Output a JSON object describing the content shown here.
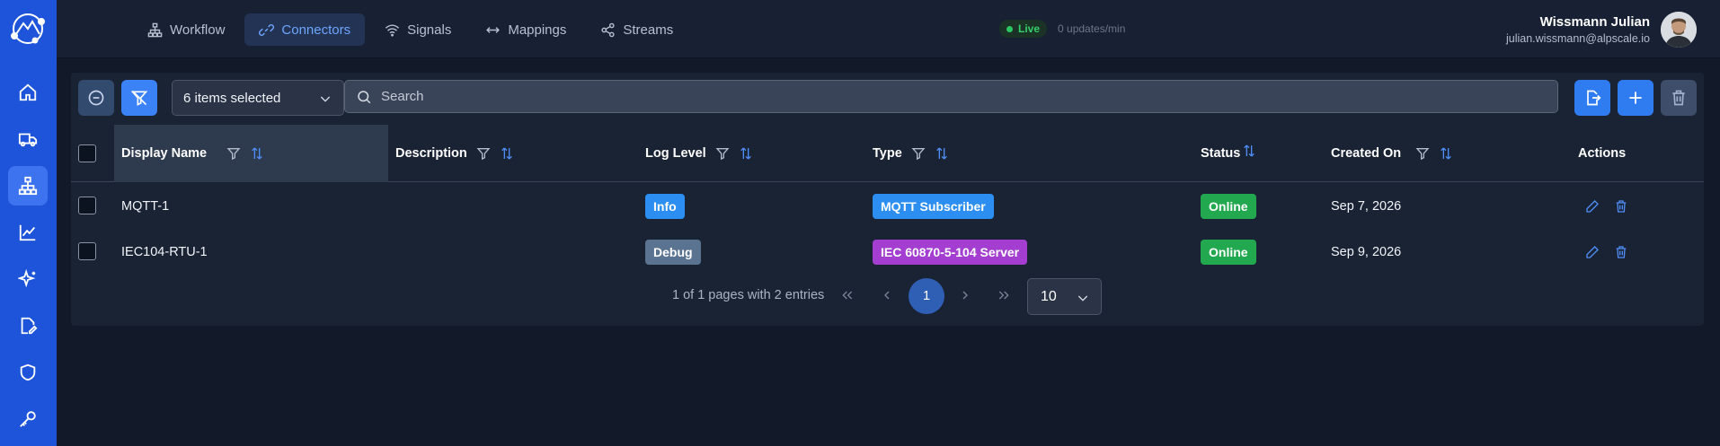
{
  "nav": {
    "tabs": [
      {
        "label": "Workflow",
        "icon": "workflow-icon"
      },
      {
        "label": "Connectors",
        "icon": "link-icon",
        "active": true
      },
      {
        "label": "Signals",
        "icon": "wifi-icon"
      },
      {
        "label": "Mappings",
        "icon": "arrows-icon"
      },
      {
        "label": "Streams",
        "icon": "share-icon"
      }
    ]
  },
  "status": {
    "live_label": "Live",
    "rate": "0 updates/min"
  },
  "user": {
    "name": "Wissmann Julian",
    "email": "julian.wissmann@alpscale.io"
  },
  "toolbar": {
    "selection_label": "6 items selected",
    "search_placeholder": "Search"
  },
  "table": {
    "headers": {
      "display_name": "Display Name",
      "description": "Description",
      "log_level": "Log Level",
      "type": "Type",
      "status": "Status",
      "created_on": "Created On",
      "actions": "Actions"
    },
    "rows": [
      {
        "display_name": "MQTT-1",
        "description": "",
        "log_level": "Info",
        "type": "MQTT Subscriber",
        "status": "Online",
        "created_on": "Sep 7, 2026"
      },
      {
        "display_name": "IEC104-RTU-1",
        "description": "",
        "log_level": "Debug",
        "type": "IEC 60870-5-104 Server",
        "status": "Online",
        "created_on": "Sep 9, 2026"
      }
    ]
  },
  "pagination": {
    "info": "1 of 1 pages with 2 entries",
    "current_page": "1",
    "page_size": "10"
  },
  "colors": {
    "sidebar": "#1d54d9",
    "accent": "#3b82f6",
    "info": "#2b8ef0",
    "debug": "#5a7390",
    "mqtt": "#2b8ef0",
    "iec": "#a43ed0",
    "online": "#22a94f"
  }
}
